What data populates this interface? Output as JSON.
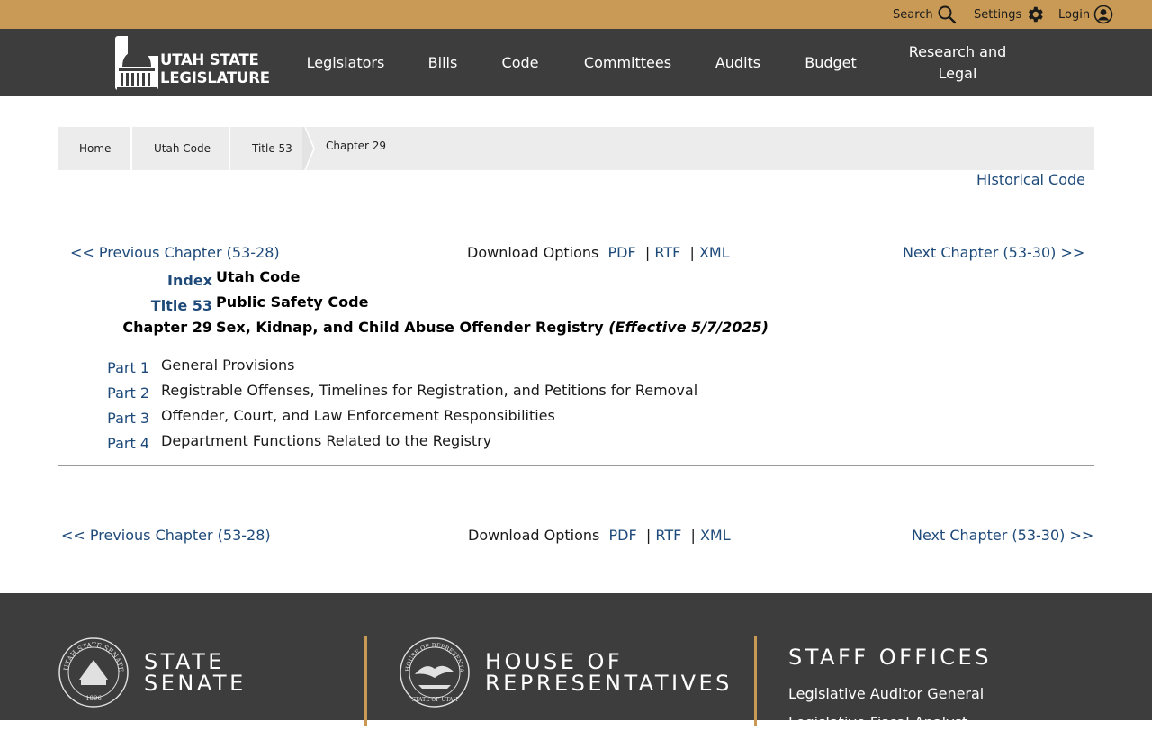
{
  "topbar": {
    "search_label": "Search",
    "settings_label": "Settings",
    "login_label": "Login"
  },
  "header": {
    "logo_line1": "UTAH STATE",
    "logo_line2": "LEGISLATURE",
    "nav": [
      "Legislators",
      "Bills",
      "Code",
      "Committees",
      "Audits",
      "Budget",
      "Research and Legal"
    ]
  },
  "breadcrumb": [
    "Home",
    "Utah Code",
    "Title 53",
    "Chapter 29"
  ],
  "historical_code": "Historical Code",
  "chapter_nav": {
    "prev": "<< Previous Chapter (53-28)",
    "next": "Next Chapter (53-30) >>",
    "download_label": "Download Options",
    "pdf": "PDF",
    "rtf": "RTF",
    "xml": "XML",
    "sep": "|"
  },
  "heading": {
    "index_key": "Index",
    "index_val": "Utah Code",
    "title_key": "Title 53",
    "title_val": "Public Safety Code",
    "chapter_key": "Chapter 29",
    "chapter_val": "Sex, Kidnap, and Child Abuse Offender Registry",
    "effective": "(Effective 5/7/2025)"
  },
  "parts": [
    {
      "key": "Part 1",
      "title": "General Provisions"
    },
    {
      "key": "Part 2",
      "title": "Registrable Offenses, Timelines for Registration, and Petitions for Removal"
    },
    {
      "key": "Part 3",
      "title": "Offender, Court, and Law Enforcement Responsibilities"
    },
    {
      "key": "Part 4",
      "title": "Department Functions Related to the Registry"
    }
  ],
  "footer": {
    "senate_line1": "STATE",
    "senate_line2": "SENATE",
    "house_line1": "HOUSE OF",
    "house_line2": "REPRESENTATIVES",
    "staff_title": "STAFF OFFICES",
    "staff_links": [
      "Legislative Auditor General",
      "Legislative Fiscal Analyst"
    ],
    "senate_seal_text": "UTAH STATE SENATE SEAL",
    "senate_seal_year": "1896",
    "house_seal_text": "HOUSE OF REPRESENTATIVES",
    "house_seal_bottom": "STATE OF UTAH"
  },
  "colors": {
    "topbar": "#c89a55",
    "nav_bg": "#3d3d3d",
    "link": "#1e4a7a",
    "breadcrumb_bg": "#ececec"
  }
}
